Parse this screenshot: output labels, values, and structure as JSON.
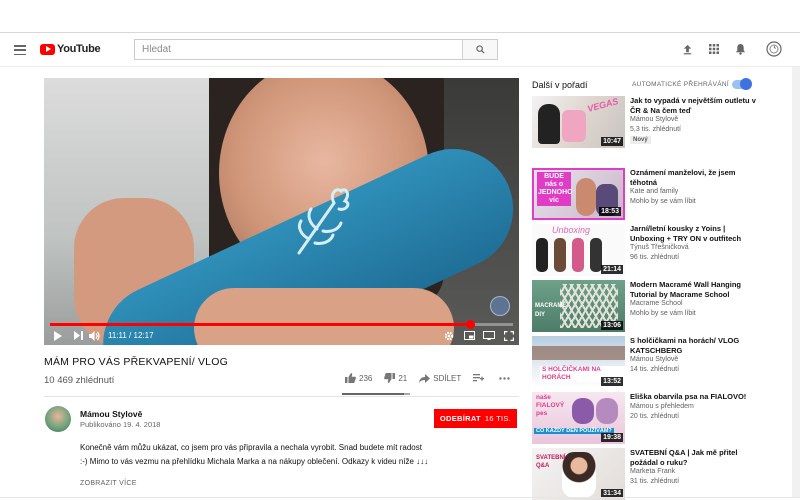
{
  "header": {
    "logo_text": "YouTube",
    "search_placeholder": "Hledat"
  },
  "player": {
    "time": "11:11 / 12:17",
    "progress_fraction": 0.908
  },
  "video": {
    "title": "MÁM PRO VÁS PŘEKVAPENÍ/ VLOG",
    "views": "10 469 zhlédnutí",
    "likes": "236",
    "dislikes": "21",
    "share_label": "SDÍLET"
  },
  "channel": {
    "name": "Mámou Stylově",
    "published": "Publikováno 19. 4. 2018",
    "subscribe_label": "ODEBÍRAT",
    "subscriber_count": "16 TIS."
  },
  "description": {
    "line1": "Konečně vám můžu ukázat,  co jsem pro vás připravila a nechala vyrobit. Snad budete mít radost",
    "line2": ":-) Mimo to vás vezmu na přehlídku Michala Marka a na nákupy oblečení. Odkazy k videu níže ↓↓↓",
    "show_more": "ZOBRAZIT VÍCE"
  },
  "sidebar": {
    "title": "Další v pořadí",
    "autoplay_label": "AUTOMATICKÉ PŘEHRÁVÁNÍ",
    "items": [
      {
        "title": "Jak to vypadá v největším outletu v ČR & Na čem teď",
        "channel": "Mámou Stylově",
        "meta": "5,3 tis. zhlédnutí",
        "badge": "Nový",
        "duration": "10:47"
      },
      {
        "title": "Oznámení manželovi, že jsem těhotná",
        "channel": "Kate and family",
        "meta": "Mohlo by se vám líbit",
        "duration": "18:53"
      },
      {
        "title": "Jarní/letní kousky z Yoins | Unboxing + TRY ON v outfitech",
        "channel": "Týnuš Třešničková",
        "meta": "96 tis. zhlédnutí",
        "duration": "21:14"
      },
      {
        "title": "Modern Macramé Wall Hanging Tutorial by Macrame School",
        "channel": "Macrame School",
        "meta": "Mohlo by se vám líbit",
        "duration": "13:06"
      },
      {
        "title": "S holčičkami na horách/ VLOG KATSCHBERG",
        "channel": "Mámou Stylově",
        "meta": "14 tis. zhlédnutí",
        "duration": "13:52"
      },
      {
        "title": "Eliška obarvila psa na FIALOVO!",
        "channel": "Mámou s přehledem",
        "meta": "20 tis. zhlédnutí",
        "duration": "19:38"
      },
      {
        "title": "SVATEBNÍ Q&A | Jak mě přitel požádal o ruku?",
        "channel": "Marketa Frank",
        "meta": "31 tis. zhlédnutí",
        "duration": "31:34"
      }
    ],
    "thumb_texts": {
      "t1": "VEGAS",
      "t2": "BUDE nás o JEDNOHO víc",
      "t3": "Unboxing",
      "t4": "MACRAMÉ DIY",
      "t5": "S HOLČIČKAMI NA HORÁCH",
      "t6": "naše FIALOVÝ pes",
      "t6b": "CO KAŽDÝ DEN POUŽÍVÁM?",
      "t7": "SVATEBNÍ Q&A"
    }
  },
  "colors": {
    "brand_red": "#ff0000",
    "toggle_blue": "#3d72e0"
  }
}
